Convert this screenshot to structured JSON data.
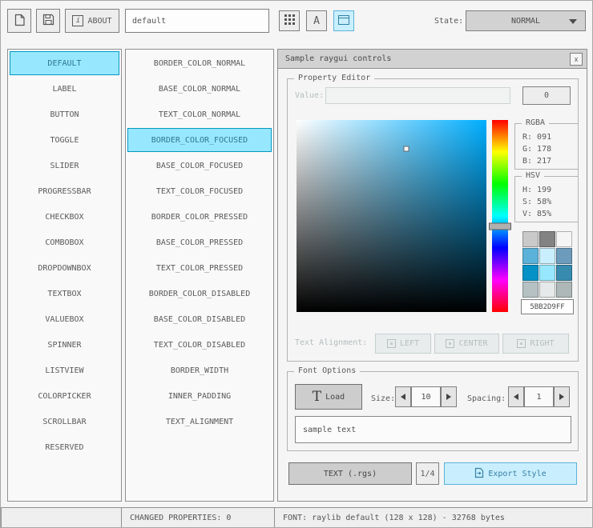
{
  "toolbar": {
    "about_label": "ABOUT",
    "style_name_value": "default",
    "state_label": "State:",
    "state_value": "NORMAL"
  },
  "icons": {
    "info_glyph": "i",
    "close_glyph": "x",
    "font_glyph": "A",
    "text_glyph": "T"
  },
  "controls_list": [
    "DEFAULT",
    "LABEL",
    "BUTTON",
    "TOGGLE",
    "SLIDER",
    "PROGRESSBAR",
    "CHECKBOX",
    "COMBOBOX",
    "DROPDOWNBOX",
    "TEXTBOX",
    "VALUEBOX",
    "SPINNER",
    "LISTVIEW",
    "COLORPICKER",
    "SCROLLBAR",
    "RESERVED"
  ],
  "selected_control_index": 0,
  "properties_list": [
    "BORDER_COLOR_NORMAL",
    "BASE_COLOR_NORMAL",
    "TEXT_COLOR_NORMAL",
    "BORDER_COLOR_FOCUSED",
    "BASE_COLOR_FOCUSED",
    "TEXT_COLOR_FOCUSED",
    "BORDER_COLOR_PRESSED",
    "BASE_COLOR_PRESSED",
    "TEXT_COLOR_PRESSED",
    "BORDER_COLOR_DISABLED",
    "BASE_COLOR_DISABLED",
    "TEXT_COLOR_DISABLED",
    "BORDER_WIDTH",
    "INNER_PADDING",
    "TEXT_ALIGNMENT"
  ],
  "selected_property_index": 3,
  "sample_window": {
    "title": "Sample raygui controls",
    "property_editor": {
      "group_label": "Property Editor",
      "value_label": "Value:",
      "value_input": "",
      "value_button_label": "0",
      "rgba_label": "RGBA",
      "rgba_lines": [
        "R: 091",
        "G: 178",
        "B: 217"
      ],
      "hsv_label": "HSV",
      "hsv_lines": [
        "H: 199",
        "S: 58%",
        "V: 85%"
      ],
      "hsv": {
        "h": 199,
        "s": 58,
        "v": 85
      },
      "hex_value": "5BB2D9FF",
      "swatches": [
        "#c9c9c9",
        "#838383",
        "#f5f5f5",
        "#5bb2d9",
        "#c9effe",
        "#6c9bbc",
        "#0492c7",
        "#97e8ff",
        "#368baf",
        "#b5c1c2",
        "#e6e9e9",
        "#aeb7b8"
      ],
      "text_alignment_label": "Text Alignment:",
      "align_buttons": [
        "LEFT",
        "CENTER",
        "RIGHT"
      ]
    },
    "font_options": {
      "group_label": "Font Options",
      "load_button_label": "Load",
      "size_label": "Size:",
      "size_value": "10",
      "spacing_label": "Spacing:",
      "spacing_value": "1",
      "sample_text": "sample text"
    },
    "export_row": {
      "text_rgs_label": "TEXT (.rgs)",
      "pages_label": "1/4",
      "export_label": "Export Style"
    }
  },
  "status_bar": {
    "changed_properties": "CHANGED PROPERTIES: 0",
    "font_info": "FONT: raylib default (128 x 128) - 32768 bytes"
  },
  "colors": {
    "accent_border": "#5bb2d9",
    "accent_fill": "#c9effe",
    "selected_border": "#0492c7",
    "selected_fill": "#97e8ff",
    "panel_border": "#838383",
    "text": "#5a5a5a"
  }
}
